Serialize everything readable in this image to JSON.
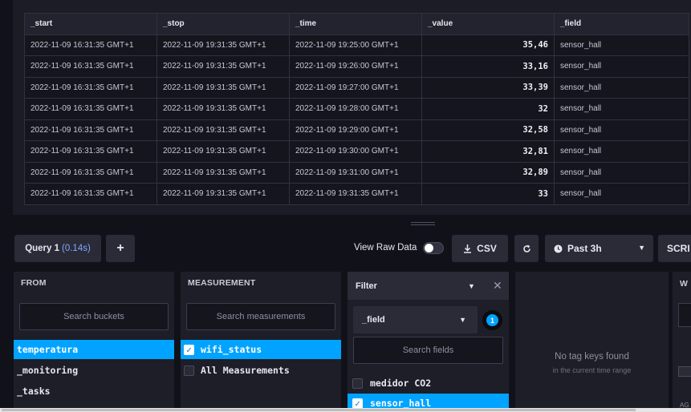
{
  "table": {
    "columns": [
      "_start",
      "_stop",
      "_time",
      "_value",
      "_field"
    ],
    "rows": [
      [
        "2022-11-09 16:31:35 GMT+1",
        "2022-11-09 19:31:35 GMT+1",
        "2022-11-09 19:25:00 GMT+1",
        "35,46",
        "sensor_hall"
      ],
      [
        "2022-11-09 16:31:35 GMT+1",
        "2022-11-09 19:31:35 GMT+1",
        "2022-11-09 19:26:00 GMT+1",
        "33,16",
        "sensor_hall"
      ],
      [
        "2022-11-09 16:31:35 GMT+1",
        "2022-11-09 19:31:35 GMT+1",
        "2022-11-09 19:27:00 GMT+1",
        "33,39",
        "sensor_hall"
      ],
      [
        "2022-11-09 16:31:35 GMT+1",
        "2022-11-09 19:31:35 GMT+1",
        "2022-11-09 19:28:00 GMT+1",
        "32",
        "sensor_hall"
      ],
      [
        "2022-11-09 16:31:35 GMT+1",
        "2022-11-09 19:31:35 GMT+1",
        "2022-11-09 19:29:00 GMT+1",
        "32,58",
        "sensor_hall"
      ],
      [
        "2022-11-09 16:31:35 GMT+1",
        "2022-11-09 19:31:35 GMT+1",
        "2022-11-09 19:30:00 GMT+1",
        "32,81",
        "sensor_hall"
      ],
      [
        "2022-11-09 16:31:35 GMT+1",
        "2022-11-09 19:31:35 GMT+1",
        "2022-11-09 19:31:00 GMT+1",
        "32,89",
        "sensor_hall"
      ],
      [
        "2022-11-09 16:31:35 GMT+1",
        "2022-11-09 19:31:35 GMT+1",
        "2022-11-09 19:31:35 GMT+1",
        "33",
        "sensor_hall"
      ]
    ]
  },
  "toolbar": {
    "query_tab_label": "Query 1",
    "query_tab_time": "(0.14s)",
    "add_query_label": "+",
    "view_raw_label": "View Raw Data",
    "view_raw_on": false,
    "csv_label": "CSV",
    "range_label": "Past 3h",
    "script_label": "SCRI"
  },
  "from": {
    "title": "FROM",
    "search_placeholder": "Search buckets",
    "items": [
      {
        "label": "temperatura",
        "selected": true
      },
      {
        "label": "_monitoring",
        "selected": false
      },
      {
        "label": "_tasks",
        "selected": false
      }
    ]
  },
  "measurement": {
    "title": "MEASUREMENT",
    "search_placeholder": "Search measurements",
    "items": [
      {
        "label": "wifi_status",
        "selected": true
      },
      {
        "label": "All Measurements",
        "selected": false
      }
    ]
  },
  "filter": {
    "title": "Filter",
    "key_label": "_field",
    "count": "1",
    "search_placeholder": "Search fields",
    "items": [
      {
        "label": "medidor CO2",
        "selected": false
      },
      {
        "label": "sensor_hall",
        "selected": true
      }
    ]
  },
  "tags": {
    "empty_title": "No tag keys found",
    "empty_subtitle": "in the current time range"
  },
  "next_col": {
    "title": "W",
    "footer": "AG"
  },
  "colors": {
    "accent": "#00a3ff",
    "background": "#111219",
    "panel": "#1d1e28"
  }
}
